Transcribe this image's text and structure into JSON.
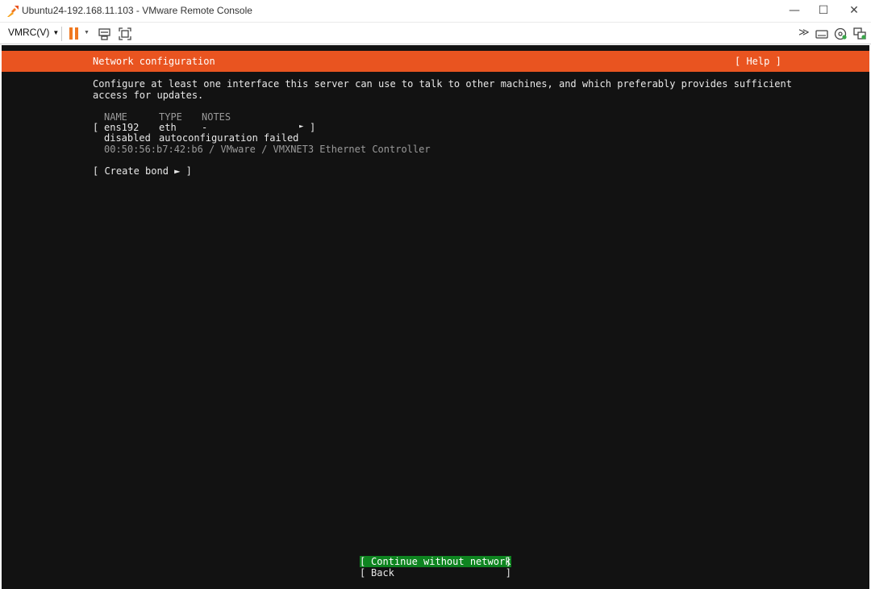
{
  "window": {
    "title": "Ubuntu24-192.168.11.103 - VMware Remote Console",
    "minimize_glyph": "—",
    "maximize_glyph": "☐",
    "close_glyph": "✕"
  },
  "toolbar": {
    "vmrc_menu_label": "VMRC(V)",
    "icons": [
      "pause-icon",
      "send-keys-icon",
      "fullscreen-icon",
      "more-icon",
      "removable-devices-icon",
      "cd-dvd-icon",
      "unity-icon"
    ],
    "more_glyph": "≫",
    "accent_color": "#f07820"
  },
  "installer": {
    "header_title": "Network configuration",
    "help_label": "[ Help ]",
    "header_color": "#e95420",
    "description_line1": "Configure at least one interface this server can use to talk to other machines, and which preferably provides sufficient",
    "description_line2": "access for updates.",
    "table": {
      "columns": [
        "NAME",
        "TYPE",
        "NOTES"
      ],
      "interfaces": [
        {
          "open_bracket": "[",
          "name": "ens192",
          "type": "eth",
          "notes": "-",
          "arrow": "►",
          "close_bracket": "]",
          "state": "disabled",
          "status": "autoconfiguration failed",
          "hardware": "00:50:56:b7:42:b6 / VMware / VMXNET3 Ethernet Controller"
        }
      ]
    },
    "create_bond_label": "[ Create bond ► ]",
    "buttons": {
      "continue_label": "Continue without network",
      "back_label": "Back",
      "bracket_open": "[",
      "bracket_close": "]",
      "primary_color": "#0e8420"
    }
  }
}
